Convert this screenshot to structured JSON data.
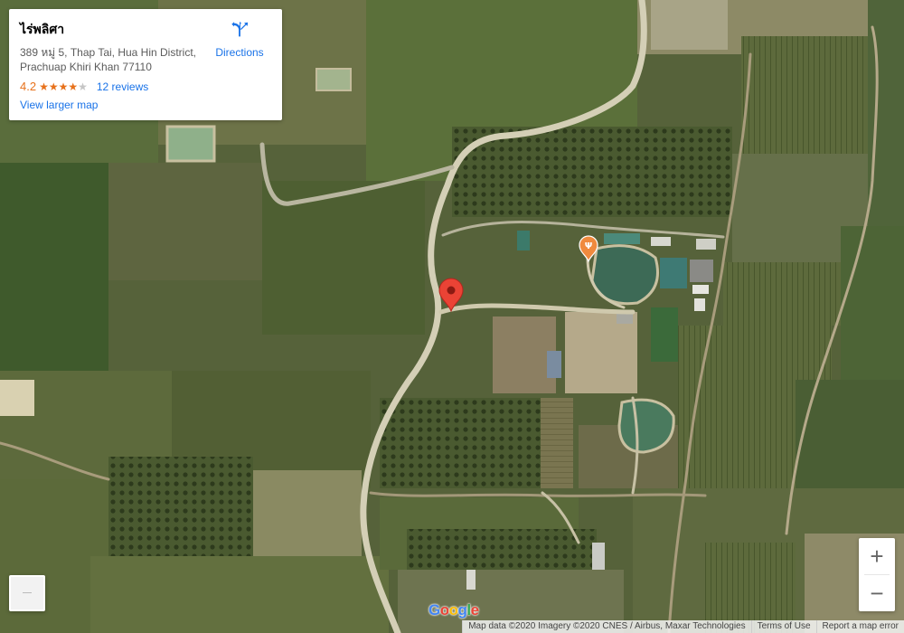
{
  "place": {
    "name": "ไร่พลิศา",
    "address_line1": "389 หมู่ 5, Thap Tai, Hua Hin District,",
    "address_line2": "Prachuap Khiri Khan 77110",
    "rating": "4.2",
    "stars_filled": 4,
    "stars_total": 5,
    "reviews_label": "12 reviews",
    "directions_label": "Directions",
    "larger_map_label": "View larger map"
  },
  "controls": {
    "zoom_in": "+",
    "zoom_out": "−"
  },
  "attribution": {
    "map_data": "Map data ©2020 Imagery ©2020 CNES / Airbus, Maxar Technologies",
    "terms": "Terms of Use",
    "report": "Report a map error"
  },
  "logo": "Google",
  "colors": {
    "link": "#1a73e8",
    "rating": "#e7711b",
    "marker": "#ea4335",
    "restaurant_pin": "#f08a3e"
  },
  "icons": [
    "directions-icon",
    "location-marker-icon",
    "restaurant-pin-icon"
  ]
}
